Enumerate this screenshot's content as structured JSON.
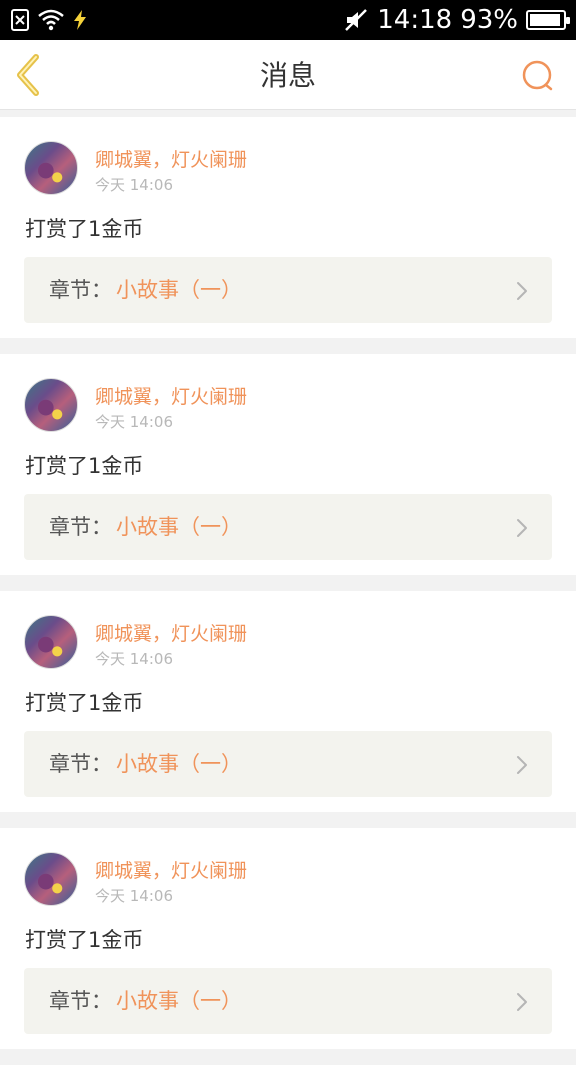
{
  "status_bar": {
    "time": "14:18",
    "battery_percent": "93%",
    "battery_level": 0.93,
    "icons": [
      "sim-x-icon",
      "wifi-icon",
      "charging-bolt-icon",
      "mute-icon",
      "battery-icon"
    ]
  },
  "header": {
    "title": "消息",
    "back_icon": "chevron-left-icon",
    "search_icon": "search-icon"
  },
  "colors": {
    "accent": "#f0935a",
    "back_icon": "#e6c24a",
    "text_primary": "#333333",
    "text_muted": "#b8b8b8",
    "chapter_bg": "#f3f3ee"
  },
  "messages": [
    {
      "user": "卿城翼，灯火阑珊",
      "time": "今天 14:06",
      "text": "打赏了1金币",
      "chapter_label": "章节：",
      "chapter_title": "小故事（一）"
    },
    {
      "user": "卿城翼，灯火阑珊",
      "time": "今天 14:06",
      "text": "打赏了1金币",
      "chapter_label": "章节：",
      "chapter_title": "小故事（一）"
    },
    {
      "user": "卿城翼，灯火阑珊",
      "time": "今天 14:06",
      "text": "打赏了1金币",
      "chapter_label": "章节：",
      "chapter_title": "小故事（一）"
    },
    {
      "user": "卿城翼，灯火阑珊",
      "time": "今天 14:06",
      "text": "打赏了1金币",
      "chapter_label": "章节：",
      "chapter_title": "小故事（一）"
    }
  ]
}
